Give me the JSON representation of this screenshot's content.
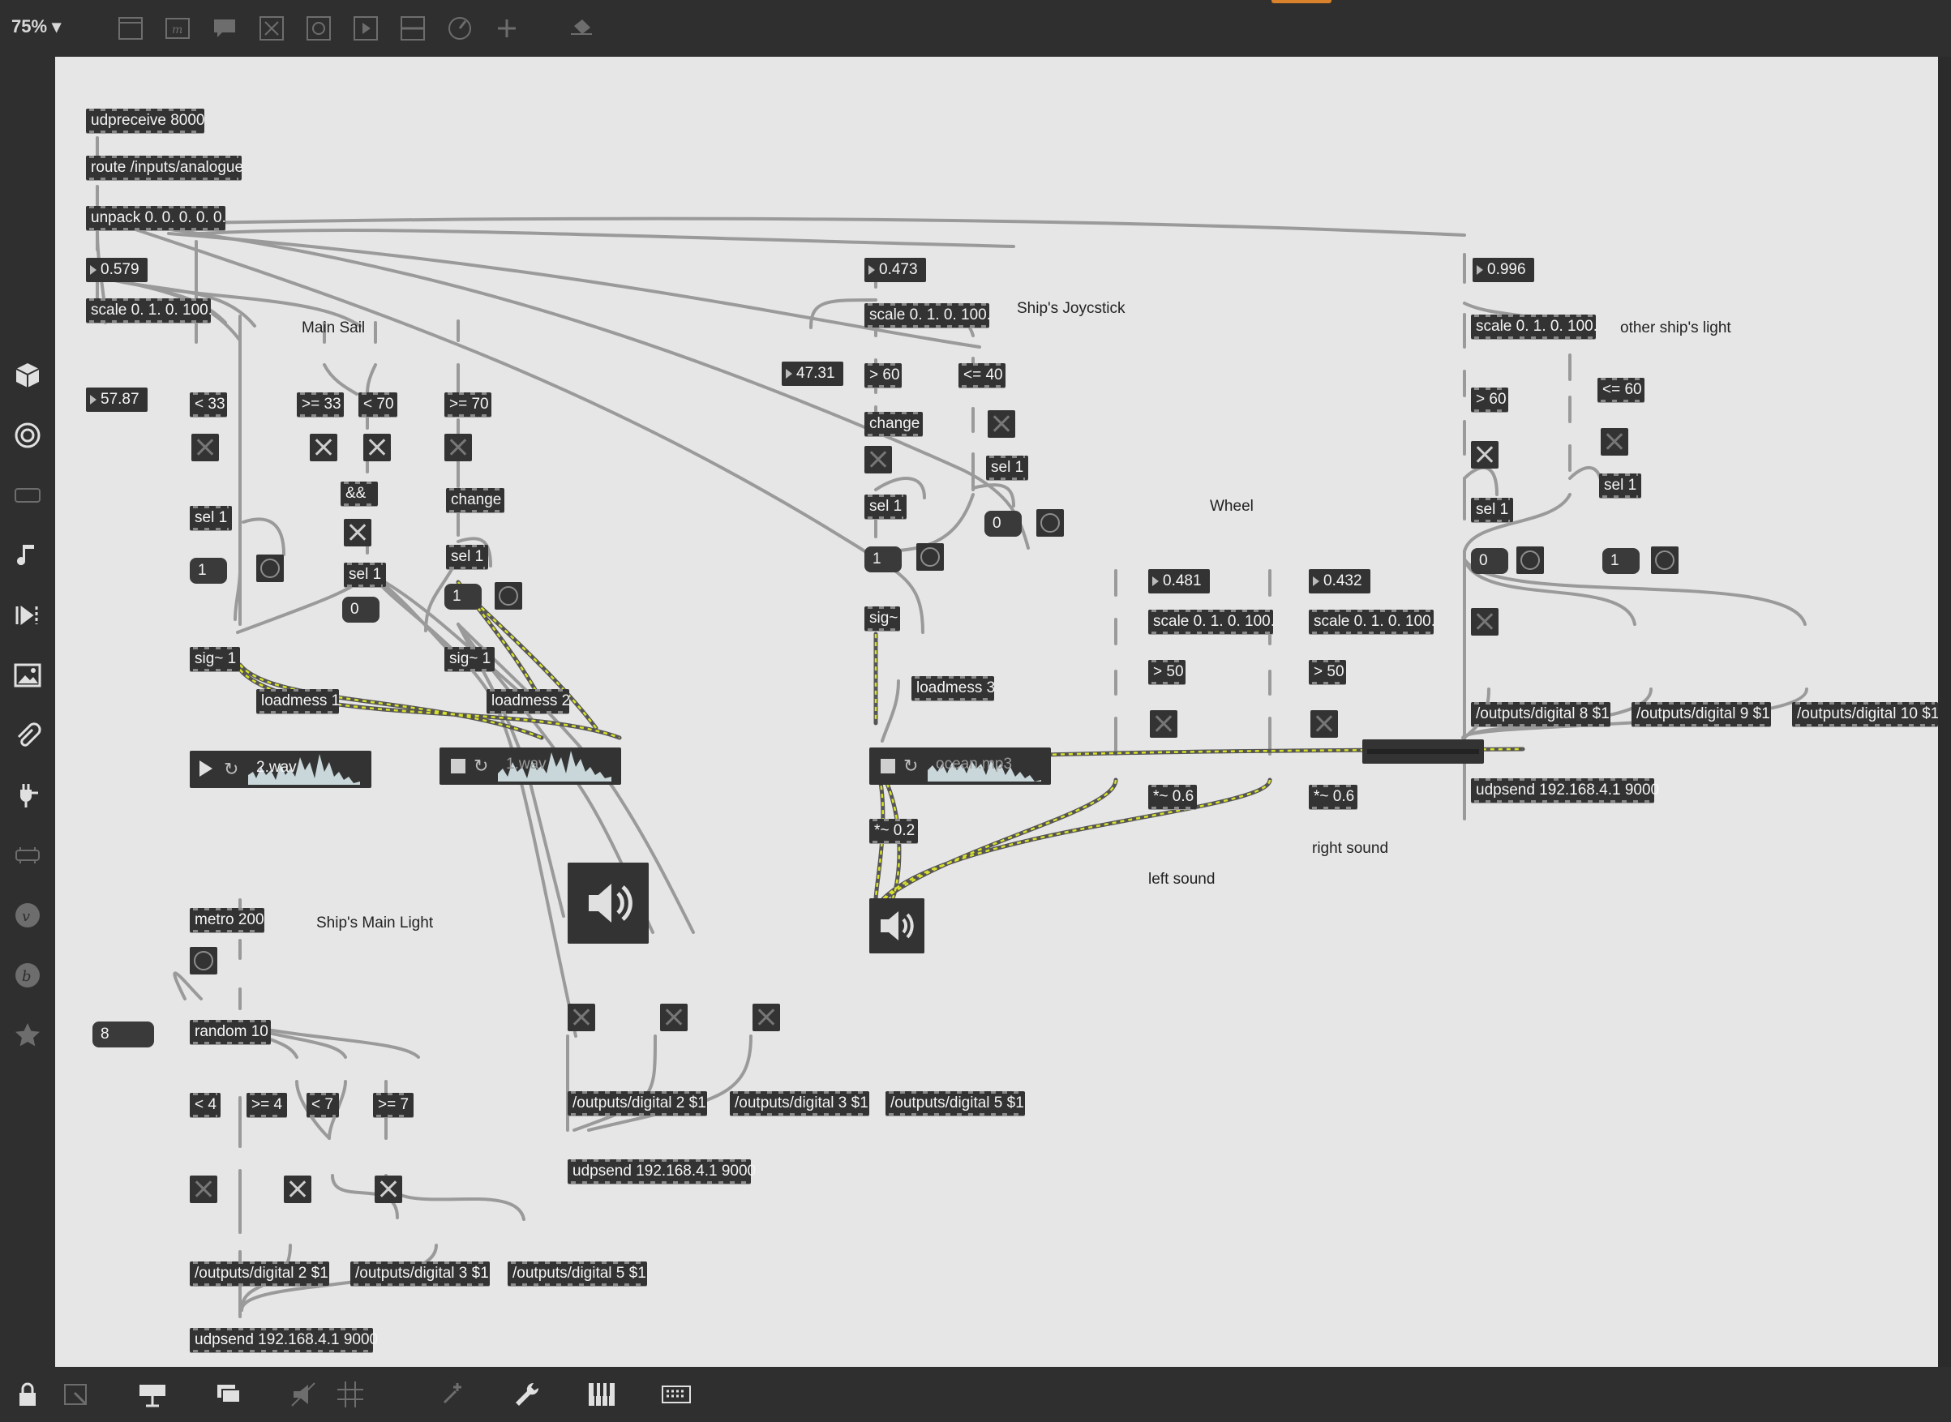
{
  "toolbar": {
    "zoom": "75%",
    "icons": [
      "sidebar-icon",
      "inspector-icon",
      "comment-icon",
      "toggle-icon",
      "bang-icon",
      "play-icon",
      "slider-icon",
      "dial-icon",
      "add-icon",
      "paint-bucket-icon"
    ]
  },
  "sidebar": {
    "icons": [
      "cube-icon",
      "target-icon",
      "video-icon",
      "music-note-icon",
      "playlist-icon",
      "image-icon",
      "paperclip-icon",
      "plug-icon",
      "connector-icon",
      "vimeo-icon",
      "beatport-icon",
      "star-icon"
    ]
  },
  "bottombar": {
    "icons": [
      "lock-icon",
      "presentation-icon",
      "window-icon",
      "windows-icon",
      "mute-icon",
      "grid-icon",
      "snap-icon",
      "wrench-icon",
      "piano-icon",
      "keyboard-icon"
    ]
  },
  "patch": {
    "objects": {
      "udpreceive": "udpreceive 8000",
      "route": "route /inputs/analogue",
      "unpack": "unpack 0. 0. 0. 0. 0.",
      "scale_main": "scale 0. 1. 0. 100.",
      "lt33": "< 33",
      "ge33": ">= 33",
      "lt70": "< 70",
      "ge70": ">= 70",
      "and": "&&",
      "change_a": "change",
      "sel1_a": "sel 1",
      "sel1_b": "sel 1",
      "sel1_c": "sel 1",
      "sig1_a": "sig~ 1",
      "sig1_b": "sig~ 1",
      "loadmess1": "loadmess 1",
      "loadmess2": "loadmess 2",
      "metro": "metro 200",
      "random": "random 10",
      "lt4": "< 4",
      "ge4": ">= 4",
      "lt7": "< 7",
      "ge7": ">= 7",
      "out2_bl": "/outputs/digital 2 $1",
      "out3_bl": "/outputs/digital 3 $1",
      "out5_bl": "/outputs/digital 5 $1",
      "udpsend_bl": "udpsend 192.168.4.1 9000",
      "out2_bm": "/outputs/digital 2 $1",
      "out3_bm": "/outputs/digital 3 $1",
      "out5_bm": "/outputs/digital 5 $1",
      "udpsend_bm": "udpsend 192.168.4.1 9000",
      "scale_joy": "scale 0. 1. 0. 100.",
      "gt60_joy": "> 60",
      "le40": "<= 40",
      "change_joy": "change",
      "sel1_joy_a": "sel 1",
      "sel1_joy_b": "sel 1",
      "sig_joy": "sig~",
      "loadmess3": "loadmess 3",
      "mul02": "*~ 0.2",
      "scale_w1": "scale 0. 1. 0. 100.",
      "scale_w2": "scale 0. 1. 0. 100.",
      "gt50_a": "> 50",
      "gt50_b": "> 50",
      "mul06_a": "*~ 0.6",
      "mul06_b": "*~ 0.6",
      "scale_other": "scale 0. 1. 0. 100.",
      "gt60_other": "> 60",
      "le60": "<= 60",
      "sel1_other_a": "sel 1",
      "sel1_other_b": "sel 1",
      "out8": "/outputs/digital 8 $1",
      "out9": "/outputs/digital 9 $1",
      "out10": "/outputs/digital 10 $1",
      "udpsend_right": "udpsend 192.168.4.1 9000"
    },
    "numbers": {
      "n0579": "0.579",
      "n5787": "57.87",
      "n0473": "0.473",
      "n4731": "47.31",
      "n0996": "0.996",
      "n0481": "0.481",
      "n0432": "0.432"
    },
    "messages": {
      "m1_a": "1",
      "m0_a": "0",
      "m1_b": "1",
      "m8": "8",
      "m1_joy": "1",
      "m0_joy": "0",
      "m0_other": "0",
      "m1_other": "1"
    },
    "comments": {
      "main_sail": "Main Sail",
      "ship_main_light": "Ship's Main Light",
      "joystick": "Ship's Joycstick",
      "wheel": "Wheel",
      "left_sound": "left sound",
      "right_sound": "right sound",
      "other_light": "other ship's light"
    },
    "players": {
      "p1": "2.wav",
      "p2": "1.wav",
      "p3": "ocean.mp3"
    }
  }
}
